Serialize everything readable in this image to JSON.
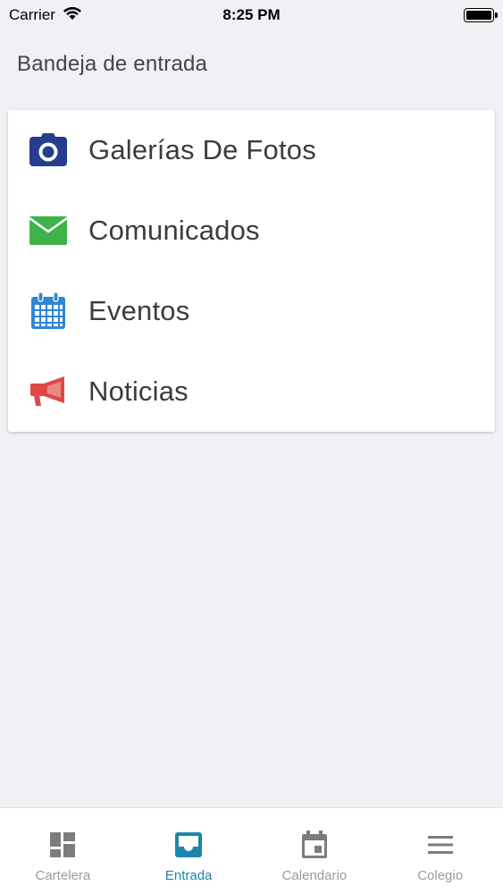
{
  "status_bar": {
    "carrier": "Carrier",
    "time": "8:25 PM",
    "battery_level": 1.0
  },
  "header": {
    "title": "Bandeja de entrada"
  },
  "menu": {
    "items": [
      {
        "label": "Galerías De Fotos",
        "icon": "camera-icon",
        "color": "#263d8f"
      },
      {
        "label": "Comunicados",
        "icon": "envelope-icon",
        "color": "#3fb24a"
      },
      {
        "label": "Eventos",
        "icon": "calendar-grid-icon",
        "color": "#2f87d6"
      },
      {
        "label": "Noticias",
        "icon": "megaphone-icon",
        "color": "#e04848"
      }
    ]
  },
  "tab_bar": {
    "active": "Entrada",
    "active_color": "#1a86ac",
    "inactive_color": "#9a9a9a",
    "tabs": [
      {
        "label": "Cartelera",
        "icon": "dashboard-icon"
      },
      {
        "label": "Entrada",
        "icon": "inbox-icon"
      },
      {
        "label": "Calendario",
        "icon": "calendar-icon"
      },
      {
        "label": "Colegio",
        "icon": "menu-icon"
      }
    ]
  }
}
